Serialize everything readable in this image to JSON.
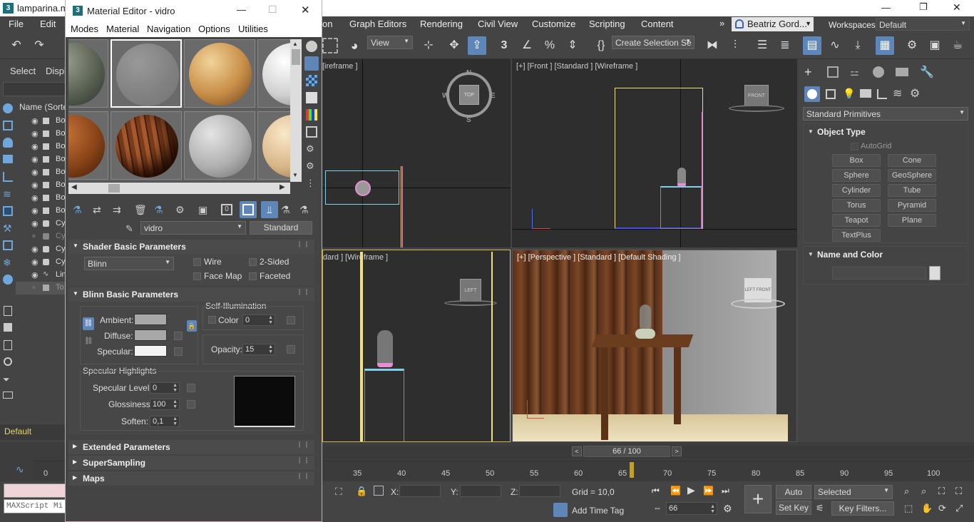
{
  "app": {
    "title": "lamparina.m",
    "window_buttons": [
      "—",
      "❐",
      "✕"
    ]
  },
  "menubar": {
    "left_items": [
      "File",
      "Edit"
    ],
    "items": [
      "on",
      "Graph Editors",
      "Rendering",
      "Civil View",
      "Customize",
      "Scripting",
      "Content"
    ],
    "overflow": "»",
    "user": "Beatriz Gord...",
    "workspaces_label": "Workspaces:",
    "workspace": "Default"
  },
  "toolbar": {
    "view_dropdown": "View",
    "selection_set": "Create Selection Se"
  },
  "scene_explorer": {
    "tabs": [
      "Select",
      "Displ"
    ],
    "column_header": "Name (Sorted",
    "rows": [
      "Bo",
      "Bo",
      "Bo",
      "Bo",
      "Bo",
      "Bo",
      "Bo",
      "Bo",
      "Cy",
      "Cy",
      "Cy",
      "Cy",
      "Lin",
      "To"
    ],
    "layer": "Default"
  },
  "viewports": {
    "top": {
      "label": "[ireframe ]",
      "compass": {
        "n": "N",
        "s": "S",
        "e": "E",
        "w": "W",
        "cube": "TOP"
      }
    },
    "front": {
      "label": "[+] [Front ] [Standard ] [Wireframe ]",
      "cube": "FRONT"
    },
    "left": {
      "label": "dard ] [Wireframe ]",
      "cube": "LEFT"
    },
    "perspective": {
      "label": "[+] [Perspective ] [Standard ] [Default Shading ]",
      "cube_left": "LEFT",
      "cube_right": "FRONT"
    }
  },
  "command_panel": {
    "category": "Standard Primitives",
    "object_type_title": "Object Type",
    "autogrid": "AutoGrid",
    "primitives": [
      "Box",
      "Cone",
      "Sphere",
      "GeoSphere",
      "Cylinder",
      "Tube",
      "Torus",
      "Pyramid",
      "Teapot",
      "Plane",
      "TextPlus"
    ],
    "name_color_title": "Name and Color",
    "name_value": ""
  },
  "material_editor": {
    "title": "Material Editor - vidro",
    "title_buttons": [
      "—",
      "☐",
      "✕"
    ],
    "menu": [
      "Modes",
      "Material",
      "Navigation",
      "Options",
      "Utilities"
    ],
    "material_name": "vidro",
    "material_type": "Standard",
    "shader_rollout": "Shader Basic Parameters",
    "shader": "Blinn",
    "shader_options": [
      "Wire",
      "2-Sided",
      "Face Map",
      "Faceted"
    ],
    "blinn_rollout": "Blinn Basic Parameters",
    "self_illum_title": "Self-Illumination",
    "color_label": "Color",
    "self_illum_value": "0",
    "ambient_label": "Ambient:",
    "diffuse_label": "Diffuse:",
    "specular_label": "Specular:",
    "opacity_label": "Opacity:",
    "opacity_value": "15",
    "spec_highlights_title": "Specular Highlights",
    "spec_level_label": "Specular Level:",
    "spec_level_value": "0",
    "gloss_label": "Glossiness:",
    "gloss_value": "100",
    "soften_label": "Soften:",
    "soften_value": "0,1",
    "extended_rollout": "Extended Parameters",
    "supersampling_rollout": "SuperSampling",
    "maps_rollout": "Maps",
    "colors": {
      "ambient": "#a8a8a8",
      "diffuse": "#a8a8a8",
      "specular": "#f2f2f2"
    }
  },
  "timeline": {
    "frame_display": "66 / 100",
    "ticks": [
      "0",
      "35",
      "40",
      "45",
      "50",
      "55",
      "60",
      "65",
      "70",
      "75",
      "80",
      "85",
      "90",
      "95",
      "100"
    ],
    "current_frame_fraction": 0.66
  },
  "statusbar": {
    "maxscript": "MAXScript Mi",
    "x_label": "X:",
    "y_label": "Y:",
    "z_label": "Z:",
    "grid": "Grid = 10,0",
    "add_time_tag": "Add Time Tag",
    "frame_spinner": "66",
    "auto_key": "Auto Key",
    "set_key": "Set Key",
    "key_mode": "Selected",
    "key_filters": "Key Filters..."
  },
  "colors": {
    "accent": "#5e86b8",
    "selection_yellow": "#f0e07a",
    "wire_pink": "#e88ed0"
  }
}
